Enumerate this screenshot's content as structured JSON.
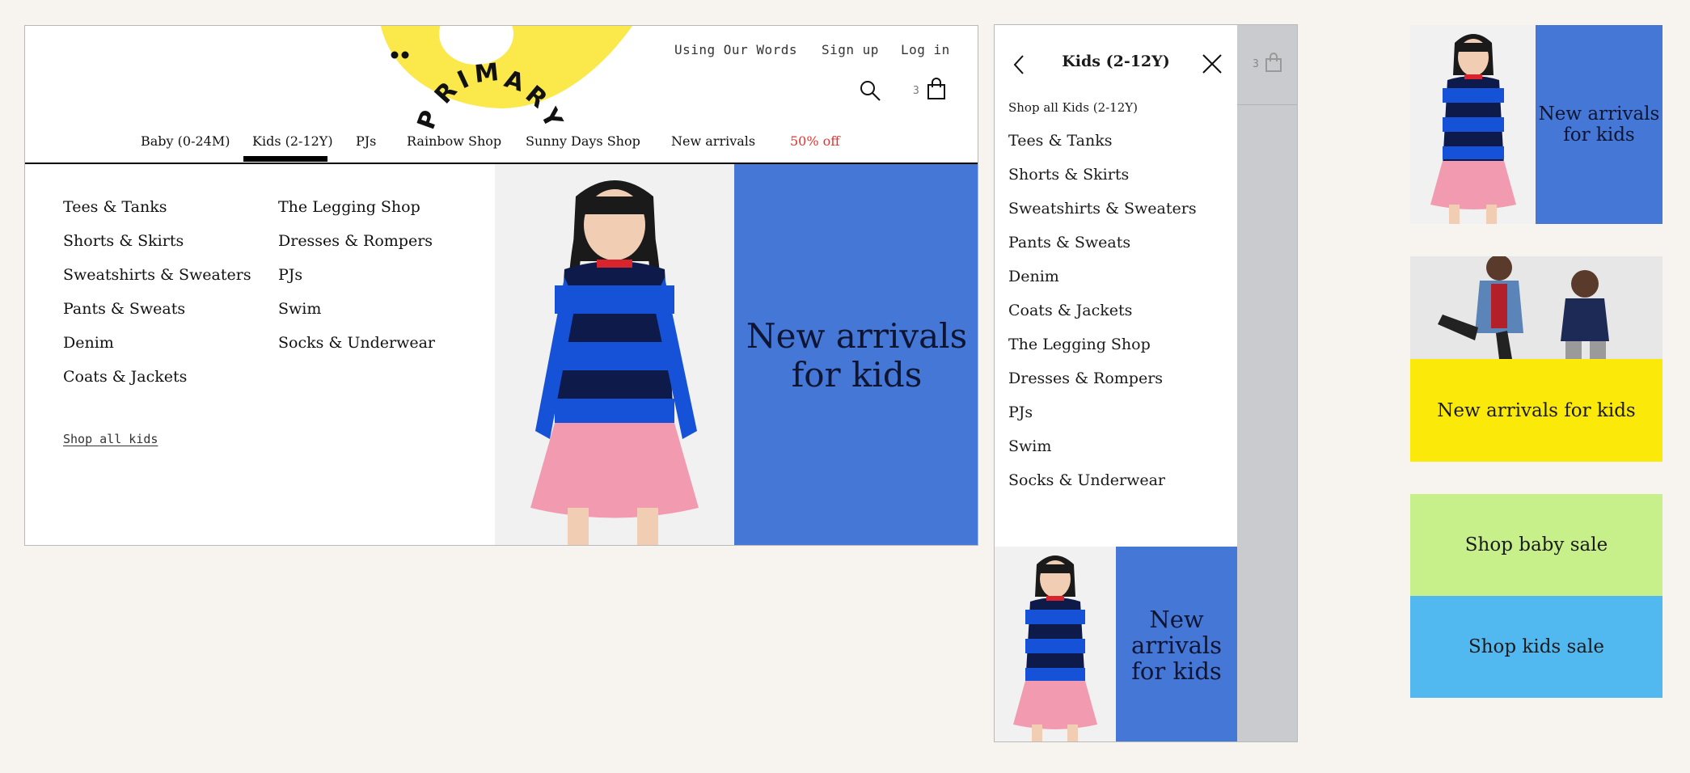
{
  "brand": {
    "logo_text": "PRIMARY",
    "logo_color": "#fbe84a"
  },
  "colors": {
    "promo_blue": "#4577d6",
    "sale_red": "#e5322d",
    "yellow": "#fbea09",
    "green": "#c7ef8a",
    "sky": "#52b9f0"
  },
  "desktop": {
    "utility_links": [
      "Using Our Words",
      "Sign up",
      "Log in"
    ],
    "cart_count": "3",
    "nav": [
      "Baby (0-24M)",
      "Kids (2-12Y)",
      "PJs",
      "Rainbow Shop",
      "Sunny Days Shop",
      "New arrivals",
      "50% off"
    ],
    "active_nav": "Kids (2-12Y)",
    "menu_col1": [
      "Tees & Tanks",
      "Shorts & Skirts",
      "Sweatshirts & Sweaters",
      "Pants & Sweats",
      "Denim",
      "Coats & Jackets"
    ],
    "menu_col2": [
      "The Legging Shop",
      "Dresses & Rompers",
      "PJs",
      "Swim",
      "Socks & Underwear"
    ],
    "shop_all": "Shop all kids",
    "promo_line1": "New arrivals",
    "promo_line2": "for kids"
  },
  "mobile": {
    "title": "Kids (2-12Y)",
    "shop_all": "Shop all Kids (2-12Y)",
    "links": [
      "Tees & Tanks",
      "Shorts & Skirts",
      "Sweatshirts & Sweaters",
      "Pants & Sweats",
      "Denim",
      "Coats & Jackets",
      "The Legging Shop",
      "Dresses & Rompers",
      "PJs",
      "Swim",
      "Socks & Underwear"
    ],
    "cart_count": "3",
    "promo_line1": "New",
    "promo_line2": "arrivals",
    "promo_line3": "for kids"
  },
  "tiles": {
    "tile1_line1": "New arrivals",
    "tile1_line2": "for kids",
    "tile2": "New arrivals for kids",
    "tile3": "Shop baby sale",
    "tile4": "Shop kids sale"
  }
}
